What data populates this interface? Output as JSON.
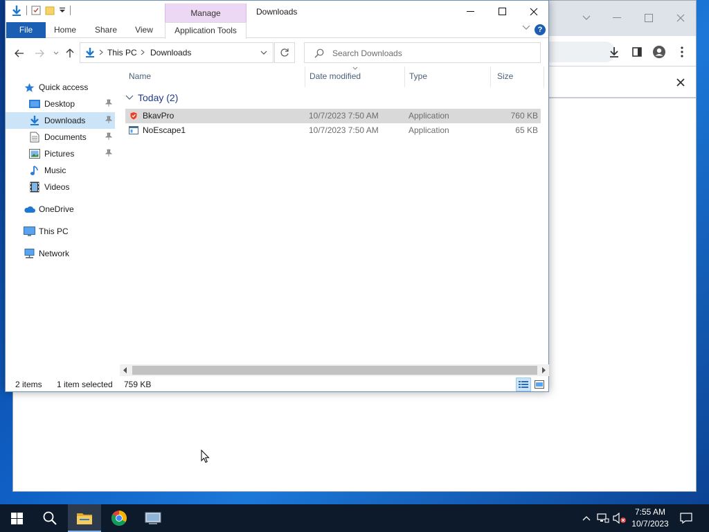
{
  "explorer": {
    "title": "Downloads",
    "context_tab": "Manage",
    "ribbon_tabs": [
      "File",
      "Home",
      "Share",
      "View",
      "Application Tools"
    ],
    "help": "?",
    "breadcrumb": [
      "This PC",
      "Downloads"
    ],
    "search_placeholder": "Search Downloads",
    "nav": {
      "quick_access": "Quick access",
      "desktop": "Desktop",
      "downloads": "Downloads",
      "documents": "Documents",
      "pictures": "Pictures",
      "music": "Music",
      "videos": "Videos",
      "onedrive": "OneDrive",
      "this_pc": "This PC",
      "network": "Network"
    },
    "columns": [
      "Name",
      "Date modified",
      "Type",
      "Size"
    ],
    "group_label": "Today (2)",
    "files": [
      {
        "name": "BkavPro",
        "date": "10/7/2023 7:50 AM",
        "type": "Application",
        "size": "760 KB",
        "selected": true
      },
      {
        "name": "NoEscape1",
        "date": "10/7/2023 7:50 AM",
        "type": "Application",
        "size": "65 KB",
        "selected": false
      }
    ],
    "status": {
      "items": "2 items",
      "selected": "1 item selected",
      "size": "759 KB"
    }
  },
  "taskbar": {
    "time": "7:55 AM",
    "date": "10/7/2023"
  },
  "icons": {
    "start": "windows-logo-icon",
    "search": "search-icon",
    "explorer": "folder-icon",
    "chrome": "chrome-icon",
    "app": "network-app-icon"
  },
  "colors": {
    "accent": "#1a5fb4",
    "selection": "#cce4f7",
    "manage": "#ecd8f4",
    "taskbar": "#0d1a2b"
  }
}
